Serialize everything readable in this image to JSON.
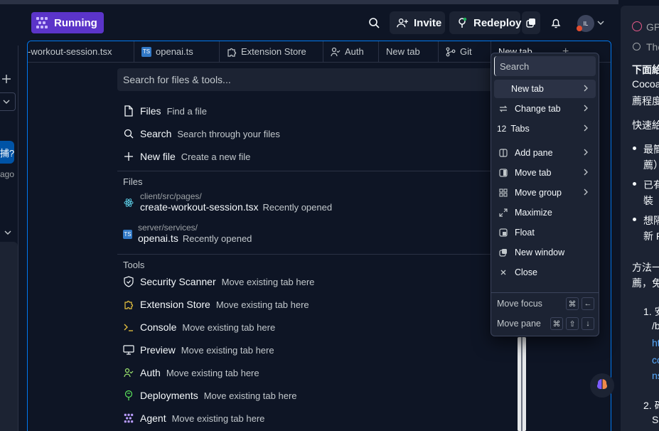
{
  "topbar": {
    "status_label": "Running",
    "invite_label": "Invite",
    "redeploy_label": "Redeploy",
    "avatar_initials": "IL"
  },
  "leftcol": {
    "pill_text": "捕?",
    "ago_text": "ago"
  },
  "tabs": [
    {
      "label": "-workout-session.tsx",
      "icon": "react-icon"
    },
    {
      "label": "openai.ts",
      "icon": "typescript-icon"
    },
    {
      "label": "Extension Store",
      "icon": "puzzle-icon"
    },
    {
      "label": "Auth",
      "icon": "user-check-icon"
    },
    {
      "label": "New tab",
      "icon": ""
    },
    {
      "label": "Git",
      "icon": "git-icon"
    },
    {
      "label": "New tab",
      "icon": ""
    }
  ],
  "tab_add_label": "+",
  "launcher": {
    "search_placeholder": "Search for files & tools...",
    "actions": [
      {
        "label": "Files",
        "sub": "Find a file",
        "icon": "file-icon"
      },
      {
        "label": "Search",
        "sub": "Search through your files",
        "icon": "search-icon"
      },
      {
        "label": "New file",
        "sub": "Create a new file",
        "icon": "plus-icon"
      }
    ],
    "files_title": "Files",
    "files": [
      {
        "path": "client/src/pages/",
        "name": "create-workout-session.tsx",
        "note": "Recently opened",
        "icon": "react-icon"
      },
      {
        "path": "server/services/",
        "name": "openai.ts",
        "note": "Recently opened",
        "icon": "typescript-icon"
      }
    ],
    "tools_title": "Tools",
    "tools": [
      {
        "label": "Security Scanner",
        "sub": "Move existing tab here",
        "icon": "shield-icon"
      },
      {
        "label": "Extension Store",
        "sub": "Move existing tab here",
        "icon": "puzzle-icon"
      },
      {
        "label": "Console",
        "sub": "Move existing tab here",
        "icon": "terminal-icon"
      },
      {
        "label": "Preview",
        "sub": "Move existing tab here",
        "icon": "monitor-icon"
      },
      {
        "label": "Auth",
        "sub": "Move existing tab here",
        "icon": "user-check-icon"
      },
      {
        "label": "Deployments",
        "sub": "Move existing tab here",
        "icon": "deploy-icon"
      },
      {
        "label": "Agent",
        "sub": "Move existing tab here",
        "icon": "agent-icon"
      }
    ]
  },
  "menu": {
    "search_placeholder": "Search",
    "items": [
      {
        "label": "New tab",
        "icon": "",
        "submenu": true
      },
      {
        "label": "Change tab",
        "icon": "swap-icon",
        "submenu": true
      },
      {
        "label": "Tabs",
        "icon": "",
        "badge": "12",
        "submenu": true
      },
      {
        "label": "Add pane",
        "icon": "split-icon",
        "submenu": true
      },
      {
        "label": "Move tab",
        "icon": "move-tab-icon",
        "submenu": true
      },
      {
        "label": "Move group",
        "icon": "grid-icon",
        "submenu": true
      },
      {
        "label": "Maximize",
        "icon": "maximize-icon",
        "submenu": false
      },
      {
        "label": "Float",
        "icon": "float-icon",
        "submenu": false
      },
      {
        "label": "New window",
        "icon": "new-window-icon",
        "submenu": false
      },
      {
        "label": "Close",
        "icon": "close-icon",
        "submenu": false
      }
    ],
    "move_focus_label": "Move focus",
    "move_pane_label": "Move pane",
    "keys": {
      "cmd": "⌘",
      "left": "←",
      "shift": "⇧",
      "down": "↓"
    }
  },
  "rightpanel": {
    "lines": [
      {
        "text": "GPT",
        "style": "muted"
      },
      {
        "text": "The",
        "style": "muted"
      },
      {
        "text": "下面給",
        "style": "bold"
      },
      {
        "text": "Cocoa",
        "style": ""
      },
      {
        "text": "薦程度",
        "style": ""
      },
      {
        "text": "快速給",
        "style": ""
      },
      {
        "text": "最簡",
        "style": ""
      },
      {
        "text": "薦）",
        "style": ""
      },
      {
        "text": "已有",
        "style": ""
      },
      {
        "text": "裝",
        "style": ""
      },
      {
        "text": "想隔",
        "style": ""
      },
      {
        "text": "新 P",
        "style": ""
      },
      {
        "text": "方法一",
        "style": ""
      },
      {
        "text": "薦，免",
        "style": ""
      },
      {
        "text": "1. 安",
        "style": ""
      },
      {
        "text": "/b",
        "style": ""
      },
      {
        "text": "ht",
        "style": "link"
      },
      {
        "text": "cc",
        "style": "link"
      },
      {
        "text": "ns",
        "style": "link"
      },
      {
        "text": "2. 確",
        "style": ""
      },
      {
        "text": "Si",
        "style": ""
      }
    ]
  }
}
